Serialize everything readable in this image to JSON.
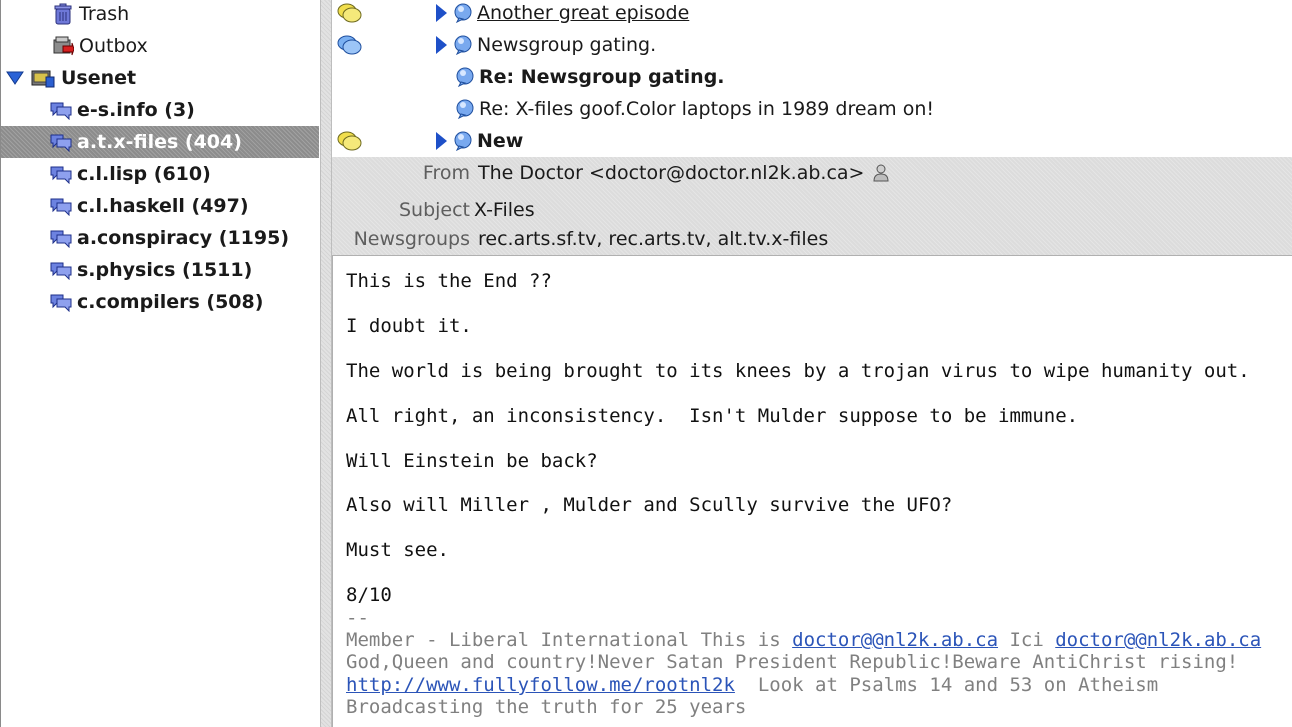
{
  "sidebar": {
    "trash": "Trash",
    "outbox": "Outbox",
    "usenet": "Usenet",
    "groups": [
      "e-s.info (3)",
      "a.t.x-files (404)",
      "c.l.lisp (610)",
      "c.l.haskell (497)",
      "a.conspiracy (1195)",
      "s.physics (1511)",
      "c.compilers (508)"
    ],
    "selected_index": 1
  },
  "threads": [
    {
      "subject": "Another great episode"
    },
    {
      "subject": "Newsgroup gating."
    },
    {
      "subject": "Re: Newsgroup gating."
    },
    {
      "subject": "Re: X-files goof.Color laptops in 1989 dream on!"
    },
    {
      "subject": "New"
    }
  ],
  "headers": {
    "from_label": "From",
    "from_value": "The Doctor <doctor@doctor.nl2k.ab.ca>",
    "subject_label": "Subject",
    "subject_value": "X-Files",
    "newsgroups_label": "Newsgroups",
    "newsgroups_value": "rec.arts.sf.tv, rec.arts.tv, alt.tv.x-files"
  },
  "body": {
    "lines": [
      "This is the End ??",
      "I doubt it.",
      "The world is being brought to its knees by a trojan virus to wipe humanity out.",
      "All right, an inconsistency.  Isn't Mulder suppose to be immune.",
      "Will Einstein be back?",
      "Also will Miller , Mulder and Scully survive the UFO?",
      "Must see.",
      "8/10"
    ],
    "sig_sep": "--",
    "sig1_prefix": "Member - Liberal International This is ",
    "sig1_link1": "doctor@@nl2k.ab.ca",
    "sig1_mid": " Ici ",
    "sig1_link2": "doctor@@nl2k.ab.ca",
    "sig2": "God,Queen and country!Never Satan President Republic!Beware AntiChrist rising!",
    "sig3_link": "http://www.fullyfollow.me/rootnl2k",
    "sig3_rest": "  Look at Psalms 14 and 53 on Atheism",
    "sig4": "Broadcasting the truth for 25 years"
  },
  "colors": {
    "selection": "#8c8c8c",
    "link": "#2b54b8",
    "expander": "#1e50c8",
    "header_bg": "#dcdcdc"
  }
}
